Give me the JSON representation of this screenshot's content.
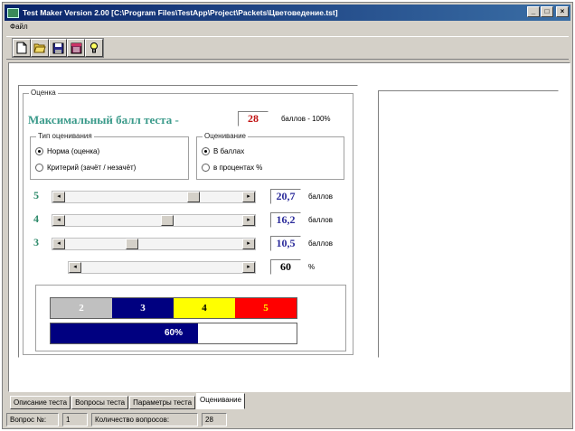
{
  "window": {
    "title": "Test Maker Version 2.00 [C:\\Program Files\\TestApp\\Project\\Packets\\Цветоведение.tst]",
    "minimize": "_",
    "maximize": "□",
    "close": "×"
  },
  "menu": {
    "file": "Файл"
  },
  "toolbar": {
    "icons": [
      "new-doc-icon",
      "open-folder-icon",
      "save-disk-icon",
      "calendar-icon",
      "hint-icon"
    ]
  },
  "rating": {
    "group_title": "Оценка",
    "max_score_label": "Максимальный балл теста -",
    "max_score_value": "28",
    "points_caption": "баллов - 100%",
    "type_group": {
      "title": "Тип оценивания",
      "options": [
        "Норма (оценка)",
        "Критерий (зачёт / незачёт)"
      ],
      "selected": 0
    },
    "unit_group": {
      "title": "Оценивание",
      "options": [
        "В баллах",
        "в процентах %"
      ],
      "selected": 0
    },
    "grades": [
      {
        "grade": "5",
        "value": "20,7",
        "unit": "баллов",
        "slider_fraction": 0.74
      },
      {
        "grade": "4",
        "value": "16,2",
        "unit": "баллов",
        "slider_fraction": 0.58
      },
      {
        "grade": "3",
        "value": "10,5",
        "unit": "баллов",
        "slider_fraction": 0.37
      },
      {
        "grade": "",
        "value": "60",
        "unit": "%",
        "slider_fraction": 0.0
      }
    ],
    "grade_bar": [
      {
        "label": "2",
        "bg": "#c0c0c0",
        "fg": "#ffffff"
      },
      {
        "label": "3",
        "bg": "#000080",
        "fg": "#ffffff"
      },
      {
        "label": "4",
        "bg": "#ffff00",
        "fg": "#000000"
      },
      {
        "label": "5",
        "bg": "#ff0000",
        "fg": "#ffff00"
      }
    ],
    "progress_text": "60%",
    "progress_value": 0.6
  },
  "tabs": [
    "Описание теста",
    "Вопросы теста",
    "Параметры теста",
    "Оценивание"
  ],
  "active_tab": 3,
  "status": {
    "question_label": "Вопрос №:",
    "question_value": "1",
    "count_label": "Количество вопросов:",
    "count_value": "28"
  },
  "colors": {
    "title_bar": "#0a246a",
    "accent_teal": "#3a9a8a",
    "score_red": "#c01010"
  }
}
